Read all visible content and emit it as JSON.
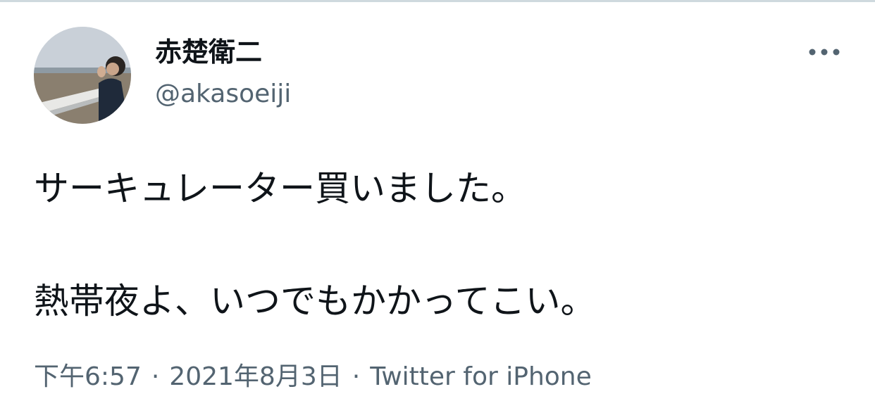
{
  "user": {
    "display_name": "赤楚衛二",
    "handle": "@akasoeiji",
    "avatar_icon": "profile-photo"
  },
  "menu": {
    "icon": "more-horizontal-icon"
  },
  "tweet": {
    "line1": "サーキュレーター買いました。",
    "line2": "熱帯夜よ、いつでもかかってこい。"
  },
  "meta": {
    "time": "下午6:57",
    "separator": "·",
    "date": "2021年8月3日",
    "source": "Twitter for iPhone"
  },
  "colors": {
    "text_primary": "#0f1419",
    "text_secondary": "#536471",
    "divider": "#cfd9de"
  }
}
